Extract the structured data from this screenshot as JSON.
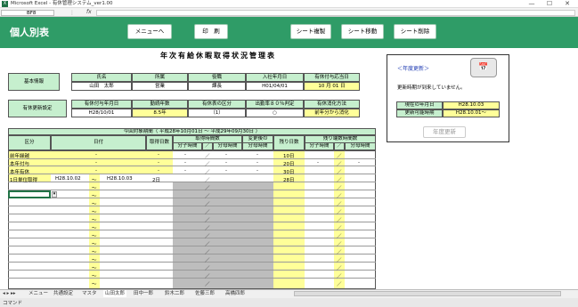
{
  "window": {
    "app_title": "Microsoft Excel - 有休管理システム_ver1.00",
    "name_box": "BF8",
    "fx_label": "fx",
    "minimize": "—",
    "maximize": "☐",
    "close": "✕"
  },
  "header": {
    "page_title": "個人別表",
    "buttons": {
      "menu": "メニューへ",
      "print": "印　刷",
      "copy_sheet": "シート複製",
      "move_sheet": "シート移動",
      "delete_sheet": "シート削除"
    }
  },
  "form_title": "年次有給休暇取得状況管理表",
  "basic_info": {
    "section_label": "基本情報",
    "headers": [
      "氏名",
      "所属",
      "役職",
      "入社年月日",
      "有休付与応当日"
    ],
    "values": [
      "山田　太郎",
      "営業",
      "課長",
      "H01/04/01",
      "10 月 01 日"
    ]
  },
  "renewal": {
    "section_label": "有休更新設定",
    "headers": [
      "有休付与年月日",
      "勤続年数",
      "有休表の区分",
      "出勤率８０％判定",
      "有休消化方法"
    ],
    "values": [
      "H28/10/01",
      "8.5年",
      "（1）",
      "○",
      "前年分から消化"
    ]
  },
  "period_label": "今回対象期間（ 平成28年10月01日 ～ 平成29年09月30日 ）",
  "table": {
    "headers": {
      "category": "区分",
      "date": "日付",
      "days": "取得日数",
      "acq_hours": "取得時間数",
      "numerator": "分子時間",
      "slash": "／",
      "denominator": "分母時間",
      "after_change": "変更後の",
      "after_change2": "分母時間",
      "remaining": "残り日数",
      "rem_hours": "残り端数時間数"
    },
    "rows": [
      {
        "category": "前年繰越",
        "date": "-",
        "days": "-",
        "num": "-",
        "den": "-",
        "chg": "-",
        "remain": "10日",
        "rnum": "",
        "rden": ""
      },
      {
        "category": "本年付与",
        "date": "-",
        "days": "-",
        "num": "-",
        "den": "-",
        "chg": "-",
        "remain": "20日",
        "rnum": "-",
        "rden": "-"
      },
      {
        "category": "本年有休",
        "date": "-",
        "days": "-",
        "num": "-",
        "den": "-",
        "chg": "-",
        "remain": "30日",
        "rnum": "",
        "rden": ""
      },
      {
        "category": "1日単位取得",
        "date_from": "H28.10.02",
        "tilde": "～",
        "date_to": "H28.10.03",
        "days": "2日",
        "remain": "28日"
      }
    ],
    "tilde": "～"
  },
  "notice": {
    "title": "＜年度更新＞",
    "message": "更新時期が到来していません。",
    "current_label": "現在の年月日",
    "current_value": "H28.10.03",
    "possible_label": "更新可能時期",
    "possible_value": "H28.10.01～",
    "button": "年度更新"
  },
  "sheet_tabs": [
    "メニュー",
    "共通設定",
    "マスタ",
    "山田太郎",
    "田中一郎",
    "鈴木二郎",
    "佐藤三郎",
    "高橋四郎"
  ],
  "status_text": "コマンド"
}
